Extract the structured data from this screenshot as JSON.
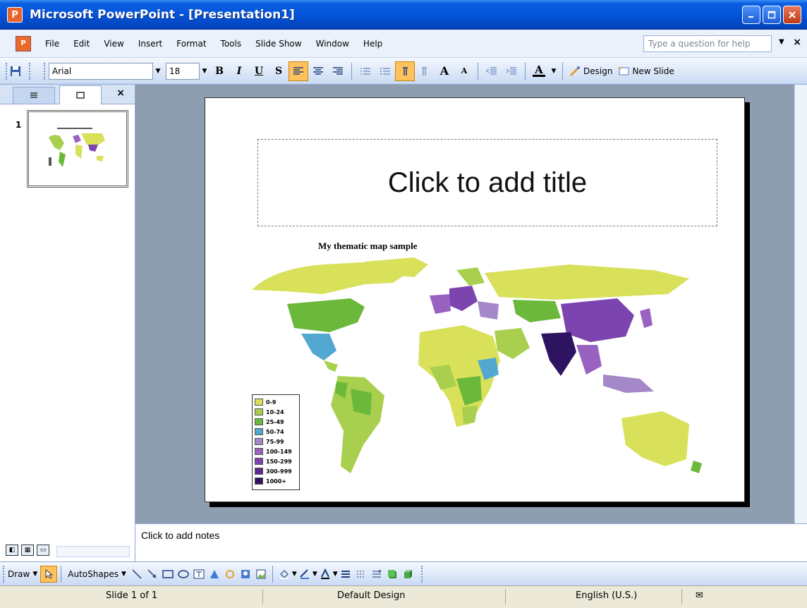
{
  "window": {
    "title": "Microsoft PowerPoint - [Presentation1]"
  },
  "menu": {
    "items": [
      "File",
      "Edit",
      "View",
      "Insert",
      "Format",
      "Tools",
      "Slide Show",
      "Window",
      "Help"
    ],
    "help_placeholder": "Type a question for help"
  },
  "toolbar": {
    "font": "Arial",
    "size": "18",
    "bold": "B",
    "italic": "I",
    "underline": "U",
    "shadow": "S",
    "grow_font": "A",
    "shrink_font": "A",
    "font_color": "A",
    "design": "Design",
    "new_slide": "New Slide"
  },
  "left_pane": {
    "slide_number": "1"
  },
  "slide": {
    "title_placeholder": "Click to add title",
    "map_title": "My thematic map sample",
    "legend": [
      {
        "label": "0-9",
        "color": "#D9E05A"
      },
      {
        "label": "10-24",
        "color": "#A8D04E"
      },
      {
        "label": "25-49",
        "color": "#6CB83A"
      },
      {
        "label": "50-74",
        "color": "#52A8D0"
      },
      {
        "label": "75-99",
        "color": "#A488C8"
      },
      {
        "label": "100-149",
        "color": "#9A62C0"
      },
      {
        "label": "150-299",
        "color": "#7C44AE"
      },
      {
        "label": "300-999",
        "color": "#5A2A8E"
      },
      {
        "label": "1000+",
        "color": "#2E1460"
      }
    ]
  },
  "notes": {
    "placeholder": "Click to add notes"
  },
  "drawbar": {
    "draw": "Draw",
    "autoshapes": "AutoShapes"
  },
  "status": {
    "slide": "Slide 1 of 1",
    "design": "Default Design",
    "language": "English (U.S.)"
  }
}
